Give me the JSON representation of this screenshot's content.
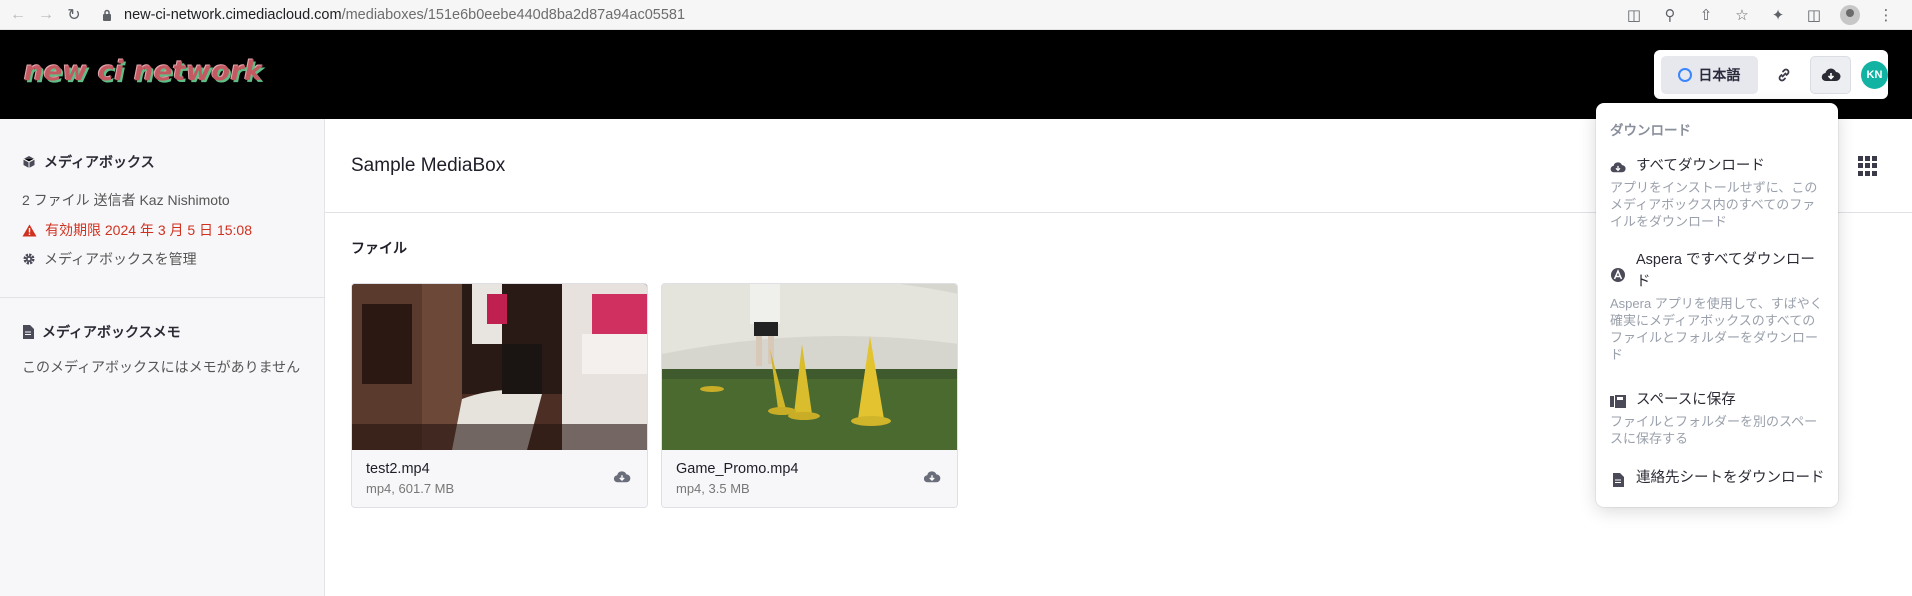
{
  "browser": {
    "url_host": "new-ci-network.cimediacloud.com",
    "url_path": "/mediaboxes/151e6b0eebe440d8ba2d87a94ac05581"
  },
  "header": {
    "logo_text": "new ci network",
    "language_label": "日本語",
    "avatar_initials": "KN"
  },
  "sidebar": {
    "mediabox_title": "メディアボックス",
    "summary": "2 ファイル 送信者 Kaz Nishimoto",
    "expiry": "有効期限 2024 年 3 月 5 日 15:08",
    "manage": "メディアボックスを管理",
    "memo_title": "メディアボックスメモ",
    "memo_text": "このメディアボックスにはメモがありません"
  },
  "main": {
    "title": "Sample MediaBox",
    "files_label": "ファイル",
    "files": [
      {
        "name": "test2.mp4",
        "info": "mp4, 601.7 MB"
      },
      {
        "name": "Game_Promo.mp4",
        "info": "mp4, 3.5 MB"
      }
    ]
  },
  "dropdown": {
    "header": "ダウンロード",
    "items": [
      {
        "title": "すべてダウンロード",
        "desc": "アプリをインストールせずに、このメディアボックス内のすべてのファイルをダウンロード",
        "icon": "cloud-download-icon"
      },
      {
        "title": "Aspera ですべてダウンロード",
        "desc": "Aspera アプリを使用して、すばやく確実にメディアボックスのすべてのファイルとフォルダーをダウンロード",
        "icon": "aspera-icon"
      },
      {
        "title": "スペースに保存",
        "desc": "ファイルとフォルダーを別のスペースに保存する",
        "icon": "save-space-icon"
      },
      {
        "title": "連絡先シートをダウンロード",
        "desc": "",
        "icon": "document-icon"
      }
    ]
  },
  "colors": {
    "warning": "#d0311f",
    "avatar": "#12b3a2",
    "header_bg": "#000000"
  }
}
